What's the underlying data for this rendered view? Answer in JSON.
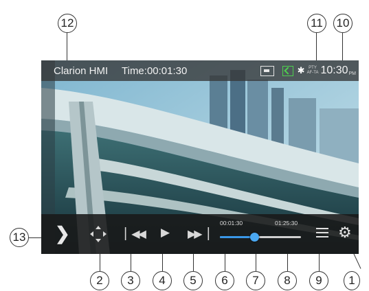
{
  "status_bar": {
    "title": "Clarion HMI",
    "time_label": "Time:00:01:30",
    "bt_icon": "bluetooth-icon",
    "pty": "PTY",
    "af_ta": "AF-TA",
    "clock": "10:30",
    "ampm": "PM"
  },
  "controls": {
    "elapsed": "00:01:30",
    "total": "01:25:30",
    "progress_fraction": 0.425,
    "progress_color": "#3a97e8"
  },
  "callouts": [
    "1",
    "2",
    "3",
    "4",
    "5",
    "6",
    "7",
    "8",
    "9",
    "10",
    "11",
    "12",
    "13"
  ]
}
